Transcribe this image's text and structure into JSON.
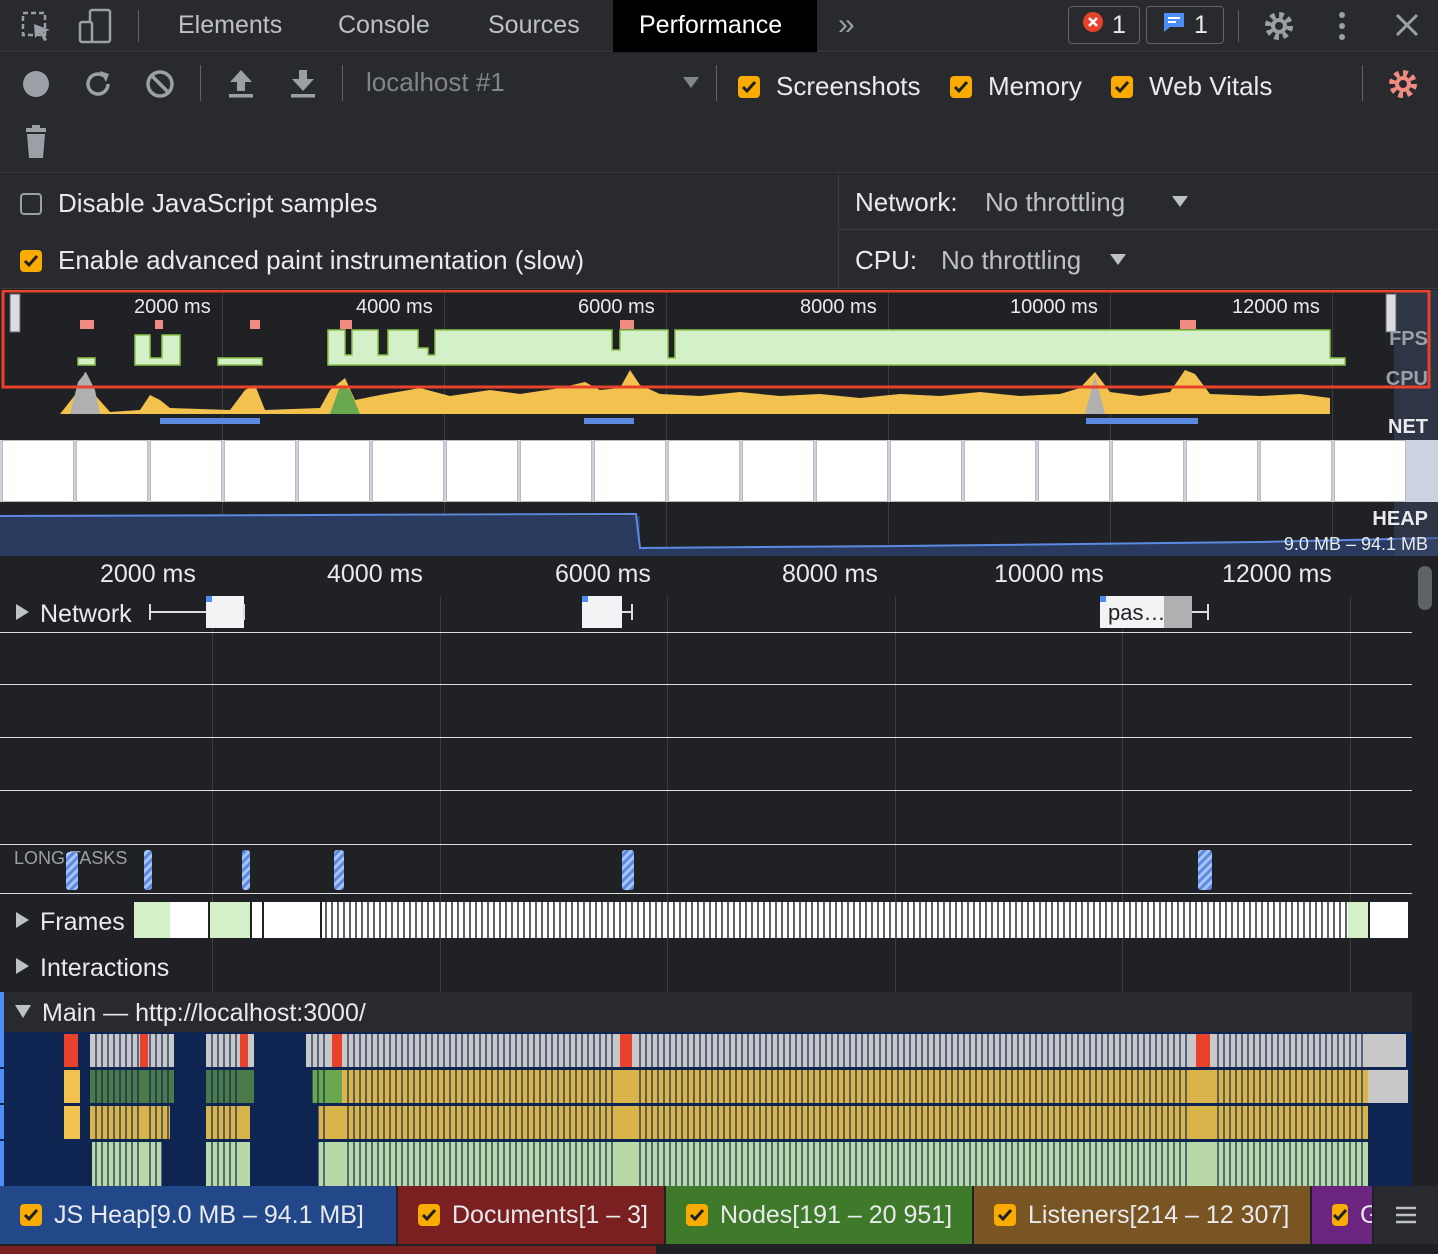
{
  "tabs": {
    "elements": "Elements",
    "console": "Console",
    "sources": "Sources",
    "performance": "Performance",
    "more": "»",
    "errors_count": "1",
    "messages_count": "1"
  },
  "toolbar": {
    "profile_select": "localhost #1",
    "screenshots_label": "Screenshots",
    "memory_label": "Memory",
    "web_vitals_label": "Web Vitals"
  },
  "settings": {
    "disable_js_samples": "Disable JavaScript samples",
    "advanced_paint": "Enable advanced paint instrumentation (slow)",
    "network_label": "Network:",
    "network_value": "No throttling",
    "cpu_label": "CPU:",
    "cpu_value": "No throttling"
  },
  "overview": {
    "ticks": [
      "2000 ms",
      "4000 ms",
      "6000 ms",
      "8000 ms",
      "10000 ms",
      "12000 ms"
    ],
    "fps_label": "FPS",
    "cpu_label": "CPU",
    "net_label": "NET",
    "heap_label": "HEAP",
    "heap_range": "9.0 MB – 94.1 MB"
  },
  "timeline": {
    "ticks": [
      "2000 ms",
      "4000 ms",
      "6000 ms",
      "8000 ms",
      "10000 ms",
      "12000 ms"
    ],
    "network_label": "Network",
    "network_item_label": "pas…",
    "long_tasks_label": "LONG TASKS",
    "frames_label": "Frames",
    "interactions_label": "Interactions",
    "main_label": "Main — http://localhost:3000/"
  },
  "memory_counters": {
    "js_heap": "JS Heap[9.0 MB – 94.1 MB]",
    "documents": "Documents[1 – 3]",
    "nodes": "Nodes[191 – 20 951]",
    "listeners": "Listeners[214 – 12 307]",
    "gpu_partial": "G"
  },
  "colors": {
    "accent_orange": "#f9ab00",
    "selection_red": "#e8412c",
    "fps_green": "#d4f0c8",
    "js_heap_bg": "#234889",
    "documents_bg": "#7a2020",
    "nodes_bg": "#3e7a2a",
    "listeners_bg": "#7a5524",
    "gpu_bg": "#6b2580"
  }
}
